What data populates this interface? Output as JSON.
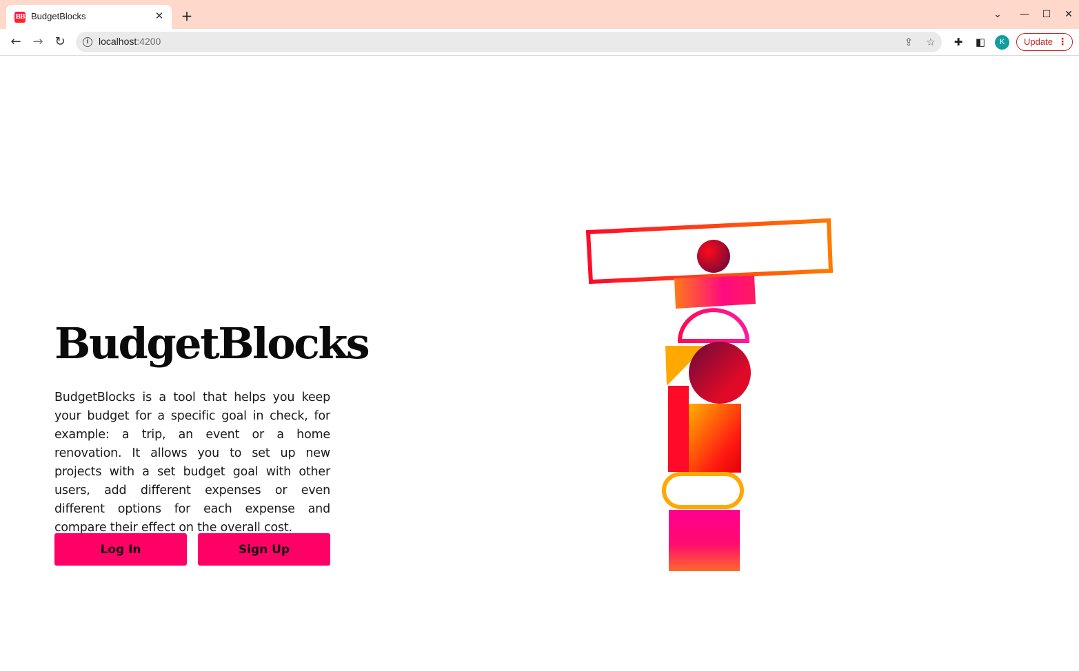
{
  "browser": {
    "tab": {
      "title": "BudgetBlocks",
      "favicon_text": "BB"
    },
    "address": {
      "host": "localhost",
      "port": ":4200"
    },
    "profile_initial": "K",
    "update_label": "Update"
  },
  "page": {
    "title": "BudgetBlocks",
    "description": "BudgetBlocks is a tool that helps you keep your budget for a specific goal in check, for example: a trip, an event or a home renovation. It allows you to set up new projects with a set budget goal with other users, add different expenses or even different options for each expense and compare their effect on the overall cost.",
    "buttons": {
      "login": "Log In",
      "signup": "Sign Up"
    }
  },
  "colors": {
    "tabbar": "#fdd8cb",
    "accent": "#ff0066",
    "update": "#c5221f",
    "avatar": "#129e9e"
  }
}
